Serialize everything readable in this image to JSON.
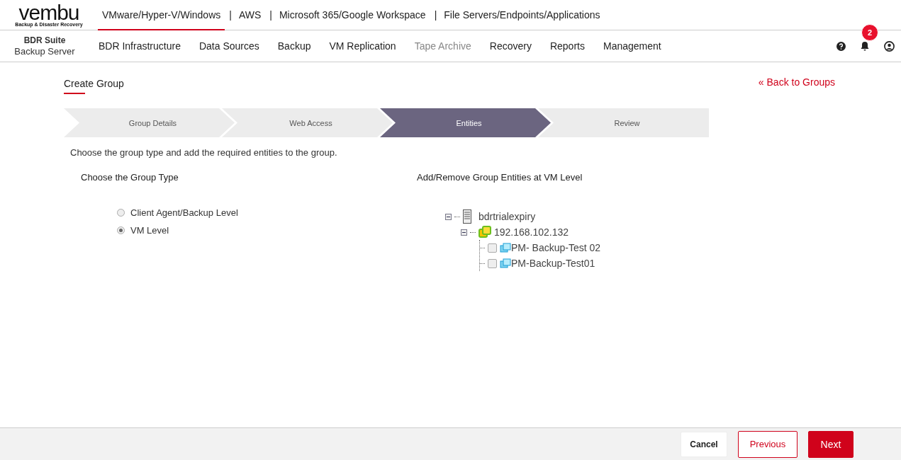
{
  "logo": {
    "name": "vembu",
    "tagline": "Backup & Disaster Recovery"
  },
  "top_nav": {
    "separator": "|",
    "tabs": [
      {
        "label": "VMware/Hyper-V/Windows",
        "selected": true
      },
      {
        "label": "AWS",
        "selected": false
      },
      {
        "label": "Microsoft 365/Google Workspace",
        "selected": false
      },
      {
        "label": "File Servers/Endpoints/Applications",
        "selected": false
      }
    ]
  },
  "product": {
    "name": "BDR Suite",
    "subtitle": "Backup Server"
  },
  "menu": [
    {
      "label": "BDR Infrastructure",
      "disabled": false
    },
    {
      "label": "Data Sources",
      "disabled": false
    },
    {
      "label": "Backup",
      "disabled": false
    },
    {
      "label": "VM Replication",
      "disabled": false
    },
    {
      "label": "Tape Archive",
      "disabled": true
    },
    {
      "label": "Recovery",
      "disabled": false
    },
    {
      "label": "Reports",
      "disabled": false
    },
    {
      "label": "Management",
      "disabled": false
    }
  ],
  "notifications": {
    "count": "2"
  },
  "page_title": "Create Group",
  "back_link": "« Back to Groups",
  "steps": [
    {
      "label": "Group Details",
      "selected": false
    },
    {
      "label": "Web Access",
      "selected": false
    },
    {
      "label": "Entities",
      "selected": true
    },
    {
      "label": "Review",
      "selected": false
    }
  ],
  "instruction": "Choose the group type and add the required entities to the group.",
  "group_type": {
    "heading": "Choose the Group Type",
    "options": [
      {
        "label": "Client Agent/Backup Level",
        "selected": false
      },
      {
        "label": "VM Level",
        "selected": true
      }
    ]
  },
  "entities": {
    "heading": "Add/Remove Group Entities at VM Level",
    "tree": [
      {
        "label": "bdrtrialexpiry",
        "kind": "server",
        "expanded": true,
        "children": [
          {
            "label": "192.168.102.132",
            "kind": "host",
            "expanded": true,
            "children": [
              {
                "label": "PM- Backup-Test 02",
                "kind": "vm",
                "checked": false
              },
              {
                "label": "PM-Backup-Test01",
                "kind": "vm",
                "checked": false
              }
            ]
          }
        ]
      }
    ]
  },
  "footer_buttons": [
    {
      "label": "Cancel",
      "kind": "plain"
    },
    {
      "label": "Previous",
      "kind": "outline"
    },
    {
      "label": "Next",
      "kind": "primary"
    }
  ]
}
